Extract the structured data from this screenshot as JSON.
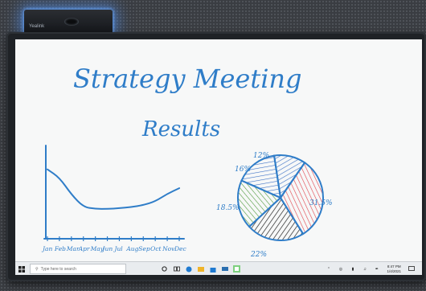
{
  "board": {
    "title": "Strategy Meeting",
    "subtitle": "Results",
    "months": [
      "Jan",
      "Feb",
      "Mar",
      "Apr",
      "May",
      "Jun",
      "Jul",
      "Aug",
      "Sep",
      "Oct",
      "Nov",
      "Dec"
    ],
    "line_values": [
      0.85,
      0.72,
      0.45,
      0.25,
      0.22,
      0.22,
      0.23,
      0.25,
      0.28,
      0.34,
      0.46,
      0.55
    ],
    "pie": [
      {
        "label": "12%",
        "value": 12,
        "hatch": "#3a6fc4"
      },
      {
        "label": "31.5%",
        "value": 31.5,
        "hatch": "#e0414a"
      },
      {
        "label": "22%",
        "value": 22,
        "hatch": "#222222"
      },
      {
        "label": "18.5%",
        "value": 18.5,
        "hatch": "#4f9a3c"
      },
      {
        "label": "16%",
        "value": 16,
        "hatch": "#3a6fc4"
      }
    ],
    "ink": "#2f7dc8"
  },
  "camera": {
    "brand": "Yealink"
  },
  "taskbar": {
    "search_placeholder": "Type here to search",
    "time": "8:47 PM",
    "date": "1/4/2021"
  }
}
